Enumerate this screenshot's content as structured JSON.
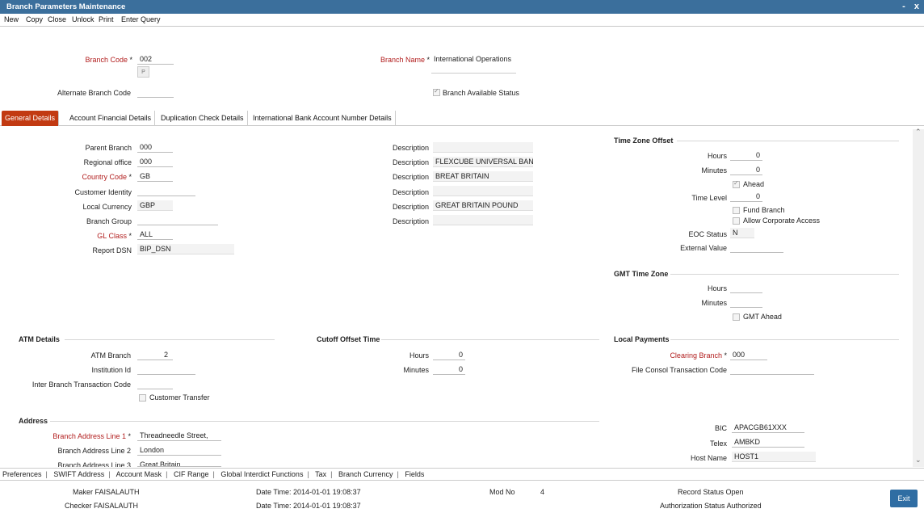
{
  "window": {
    "title": "Branch Parameters Maintenance",
    "controls": [
      "-",
      "x"
    ]
  },
  "menu": [
    "New",
    "Copy",
    "Close",
    "Unlock",
    "Print",
    "Enter Query"
  ],
  "header": {
    "branch_code_label": "Branch Code",
    "branch_code": "002",
    "p_button": "P",
    "branch_name_label": "Branch Name",
    "branch_name": "International Operations",
    "alternate_code_label": "Alternate Branch Code",
    "available_label": "Branch Available Status"
  },
  "tabs": [
    "General Details",
    "Account Financial Details",
    "Duplication Check Details",
    "International Bank Account Number Details"
  ],
  "general": {
    "parent_branch_label": "Parent Branch",
    "parent_branch": "000",
    "regional_office_label": "Regional office",
    "regional_office": "000",
    "country_code_label": "Country Code",
    "country_code": "GB",
    "customer_identity_label": "Customer Identity",
    "local_currency_label": "Local Currency",
    "local_currency": "GBP",
    "branch_group_label": "Branch Group",
    "gl_class_label": "GL Class",
    "gl_class": "ALL",
    "report_dsn_label": "Report DSN",
    "report_dsn": "BIP_DSN",
    "description_label": "Description",
    "descriptions": [
      "",
      "FLEXCUBE UNIVERSAL BAN",
      "BREAT BRITAIN",
      "",
      "GREAT BRITAIN POUND",
      ""
    ]
  },
  "time_zone": {
    "title": "Time Zone Offset",
    "hours_label": "Hours",
    "hours": "0",
    "minutes_label": "Minutes",
    "minutes": "0",
    "ahead_label": "Ahead",
    "time_level_label": "Time Level",
    "time_level": "0",
    "fund_branch_label": "Fund Branch",
    "corporate_access_label": "Allow Corporate Access",
    "eoc_status_label": "EOC Status",
    "eoc_status": "N",
    "external_value_label": "External Value"
  },
  "gmt": {
    "title": "GMT Time Zone",
    "hours_label": "Hours",
    "minutes_label": "Minutes",
    "ahead_label": "GMT Ahead"
  },
  "atm": {
    "title": "ATM Details",
    "atm_branch_label": "ATM Branch",
    "atm_branch": "2",
    "institution_label": "Institution Id",
    "inter_branch_label": "Inter Branch Transaction Code",
    "customer_transfer_label": "Customer Transfer"
  },
  "cutoff": {
    "title": "Cutoff Offset Time",
    "hours_label": "Hours",
    "hours": "0",
    "minutes_label": "Minutes",
    "minutes": "0"
  },
  "local_payments": {
    "title": "Local Payments",
    "clearing_label": "Clearing Branch",
    "clearing": "000",
    "file_consol_label": "File Consol Transaction Code"
  },
  "address": {
    "title": "Address",
    "line1_label": "Branch Address Line 1",
    "line1": "Threadneedle Street,",
    "line2_label": "Branch Address Line 2",
    "line2": "London",
    "line3_label": "Branch Address Line 3",
    "line3": "Great Britain",
    "bic_label": "BIC",
    "bic": "APACGB61XXX",
    "telex_label": "Telex",
    "telex": "AMBKD",
    "host_label": "Host Name",
    "host": "HOST1"
  },
  "bottom_nav": [
    "Preferences",
    "SWIFT Address",
    "Account Mask",
    "CIF Range",
    "Global Interdict Functions",
    "Tax",
    "Branch Currency",
    "Fields"
  ],
  "footer": {
    "maker_label": "Maker",
    "maker": "FAISALAUTH",
    "checker_label": "Checker",
    "checker": "FAISALAUTH",
    "datetime_label": "Date Time:",
    "maker_dt": "2014-01-01 19:08:37",
    "checker_dt": "2014-01-01 19:08:37",
    "modno_label": "Mod No",
    "modno": "4",
    "record_label": "Record Status",
    "record": "Open",
    "auth_label": "Authorization Status",
    "auth": "Authorized",
    "exit": "Exit"
  },
  "colors": {
    "titlebar": "#3b6f9c",
    "active_tab": "#c23a12",
    "required": "#b11c1c",
    "exit_button": "#2f6da3"
  }
}
